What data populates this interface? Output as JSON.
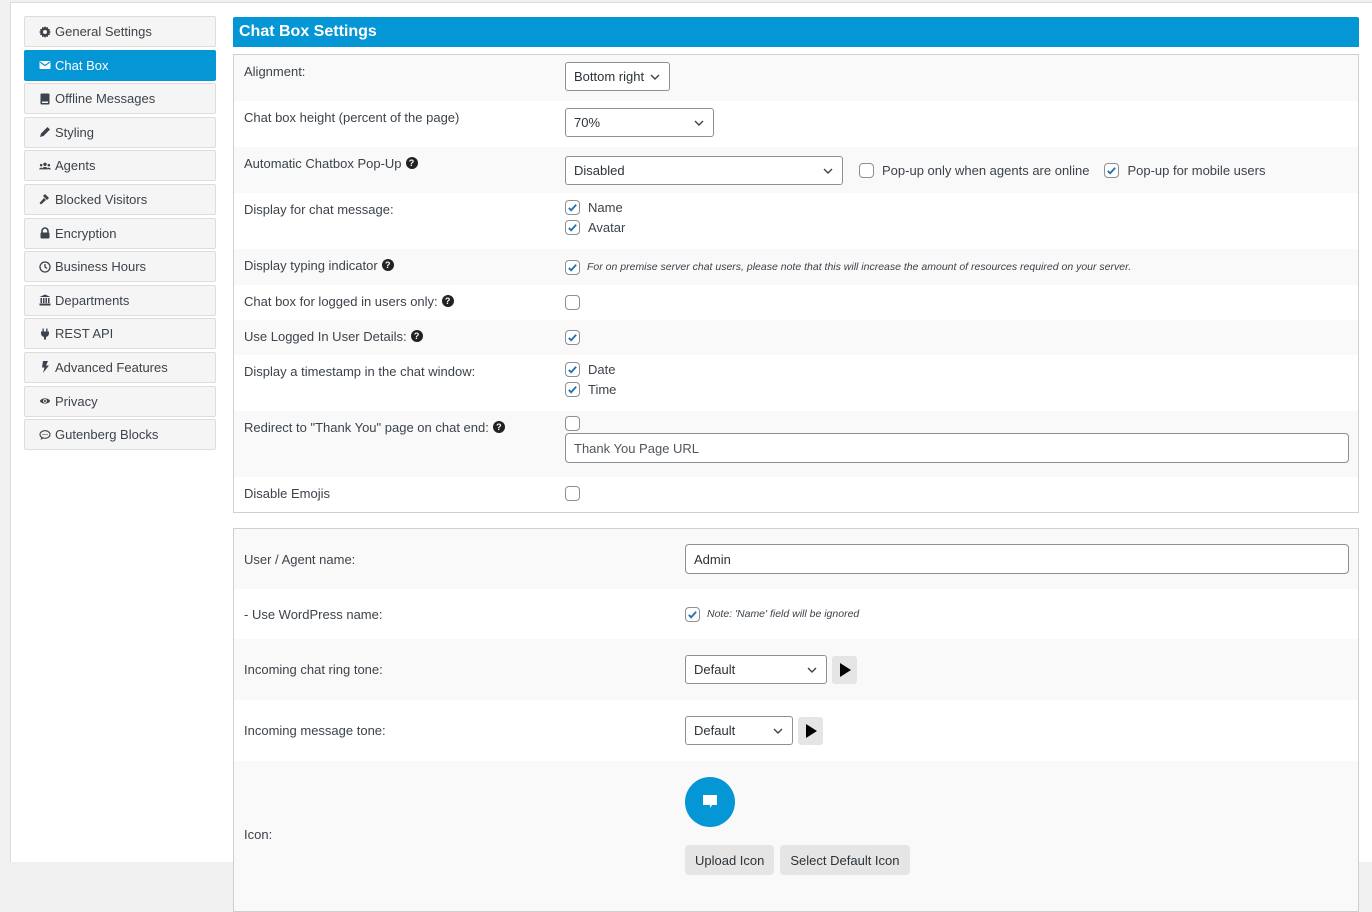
{
  "sidebar": {
    "items": [
      {
        "label": "General Settings",
        "icon": "gear-icon",
        "active": false
      },
      {
        "label": "Chat Box",
        "icon": "envelope-icon",
        "active": true
      },
      {
        "label": "Offline Messages",
        "icon": "book-icon",
        "active": false
      },
      {
        "label": "Styling",
        "icon": "pencil-icon",
        "active": false
      },
      {
        "label": "Agents",
        "icon": "users-icon",
        "active": false
      },
      {
        "label": "Blocked Visitors",
        "icon": "gavel-icon",
        "active": false
      },
      {
        "label": "Encryption",
        "icon": "lock-icon",
        "active": false
      },
      {
        "label": "Business Hours",
        "icon": "clock-icon",
        "active": false
      },
      {
        "label": "Departments",
        "icon": "university-icon",
        "active": false
      },
      {
        "label": "REST API",
        "icon": "plug-icon",
        "active": false
      },
      {
        "label": "Advanced Features",
        "icon": "bolt-icon",
        "active": false
      },
      {
        "label": "Privacy",
        "icon": "eye-icon",
        "active": false
      },
      {
        "label": "Gutenberg Blocks",
        "icon": "comment-icon",
        "active": false
      }
    ]
  },
  "main": {
    "title": "Chat Box Settings",
    "accent_color": "#0496d5",
    "settings": {
      "alignment": {
        "label": "Alignment:",
        "value": "Bottom right"
      },
      "height": {
        "label": "Chat box height (percent of the page)",
        "value": "70%"
      },
      "popup": {
        "label": "Automatic Chatbox Pop-Up",
        "value": "Disabled",
        "agents_online_label": "Pop-up only when agents are online",
        "agents_online_checked": false,
        "mobile_label": "Pop-up for mobile users",
        "mobile_checked": true
      },
      "display_message": {
        "label": "Display for chat message:",
        "options": [
          {
            "label": "Name",
            "checked": true
          },
          {
            "label": "Avatar",
            "checked": true
          }
        ]
      },
      "typing": {
        "label": "Display typing indicator",
        "checked": true,
        "note": "For on premise server chat users, please note that this will increase the amount of resources required on your server."
      },
      "logged_in_only": {
        "label": "Chat box for logged in users only:",
        "checked": false
      },
      "logged_in_details": {
        "label": "Use Logged In User Details:",
        "checked": true
      },
      "timestamp": {
        "label": "Display a timestamp in the chat window:",
        "options": [
          {
            "label": "Date",
            "checked": true
          },
          {
            "label": "Time",
            "checked": true
          }
        ]
      },
      "redirect": {
        "label": "Redirect to \"Thank You\" page on chat end:",
        "checked": false,
        "placeholder": "Thank You Page URL"
      },
      "emojis": {
        "label": "Disable Emojis",
        "checked": false
      }
    },
    "agent": {
      "name": {
        "label": "User / Agent name:",
        "value": "Admin"
      },
      "wp_name": {
        "label": "- Use WordPress name:",
        "checked": true,
        "note": "Note: 'Name' field will be ignored"
      },
      "ring_tone": {
        "label": "Incoming chat ring tone:",
        "value": "Default"
      },
      "message_tone": {
        "label": "Incoming message tone:",
        "value": "Default"
      },
      "icon": {
        "label": "Icon:",
        "upload_label": "Upload Icon",
        "default_label": "Select Default Icon"
      }
    }
  }
}
